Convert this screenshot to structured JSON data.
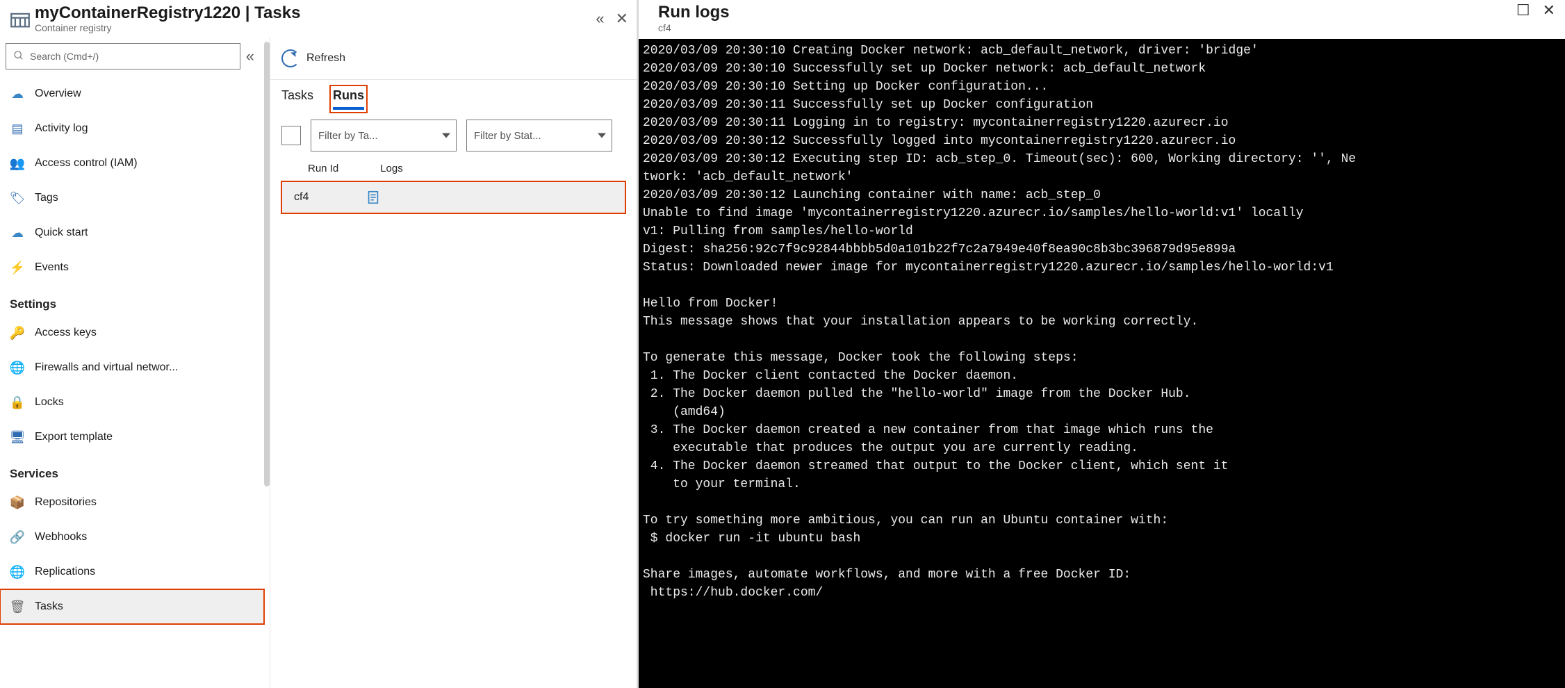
{
  "header": {
    "title": "myContainerRegistry1220 | Tasks",
    "subtitle": "Container registry"
  },
  "search": {
    "placeholder": "Search (Cmd+/)"
  },
  "sidebar": {
    "groups": [
      {
        "heading": "",
        "items": [
          {
            "id": "overview",
            "label": "Overview",
            "icon": "☁",
            "icon_color": "#3a87c7"
          },
          {
            "id": "activity-log",
            "label": "Activity log",
            "icon": "▤",
            "icon_color": "#2f6bb0"
          },
          {
            "id": "iam",
            "label": "Access control (IAM)",
            "icon": "👥",
            "icon_color": "#3a87c7"
          },
          {
            "id": "tags",
            "label": "Tags",
            "icon": "🏷",
            "icon_color": "#2f6bb0"
          },
          {
            "id": "quick-start",
            "label": "Quick start",
            "icon": "☁",
            "icon_color": "#3a87c7"
          },
          {
            "id": "events",
            "label": "Events",
            "icon": "⚡",
            "icon_color": "#f1b300"
          }
        ]
      },
      {
        "heading": "Settings",
        "items": [
          {
            "id": "access-keys",
            "label": "Access keys",
            "icon": "🔑",
            "icon_color": "#e8b400"
          },
          {
            "id": "firewalls",
            "label": "Firewalls and virtual networ...",
            "icon": "🌐",
            "icon_color": "#3aa043"
          },
          {
            "id": "locks",
            "label": "Locks",
            "icon": "🔒",
            "icon_color": "#3a87c7"
          },
          {
            "id": "export-template",
            "label": "Export template",
            "icon": "🖥",
            "icon_color": "#2f6bb0"
          }
        ]
      },
      {
        "heading": "Services",
        "items": [
          {
            "id": "repositories",
            "label": "Repositories",
            "icon": "📦",
            "icon_color": "#3a87c7"
          },
          {
            "id": "webhooks",
            "label": "Webhooks",
            "icon": "🔗",
            "icon_color": "#3a87c7"
          },
          {
            "id": "replications",
            "label": "Replications",
            "icon": "🌐",
            "icon_color": "#d08a2a"
          },
          {
            "id": "tasks",
            "label": "Tasks",
            "icon": "🗑",
            "icon_color": "#6e6e6e",
            "selected": true
          }
        ]
      }
    ]
  },
  "toolbar": {
    "refresh_label": "Refresh"
  },
  "tabs": [
    {
      "id": "tasks",
      "label": "Tasks",
      "active": false
    },
    {
      "id": "runs",
      "label": "Runs",
      "active": true
    }
  ],
  "filters": {
    "task": "Filter by Ta...",
    "status": "Filter by Stat..."
  },
  "grid": {
    "columns": [
      "Run Id",
      "Logs"
    ],
    "rows": [
      {
        "run_id": "cf4"
      }
    ]
  },
  "right": {
    "title": "Run logs",
    "subtitle": "cf4",
    "log": "2020/03/09 20:30:10 Creating Docker network: acb_default_network, driver: 'bridge'\n2020/03/09 20:30:10 Successfully set up Docker network: acb_default_network\n2020/03/09 20:30:10 Setting up Docker configuration...\n2020/03/09 20:30:11 Successfully set up Docker configuration\n2020/03/09 20:30:11 Logging in to registry: mycontainerregistry1220.azurecr.io\n2020/03/09 20:30:12 Successfully logged into mycontainerregistry1220.azurecr.io\n2020/03/09 20:30:12 Executing step ID: acb_step_0. Timeout(sec): 600, Working directory: '', Ne\ntwork: 'acb_default_network'\n2020/03/09 20:30:12 Launching container with name: acb_step_0\nUnable to find image 'mycontainerregistry1220.azurecr.io/samples/hello-world:v1' locally\nv1: Pulling from samples/hello-world\nDigest: sha256:92c7f9c92844bbbb5d0a101b22f7c2a7949e40f8ea90c8b3bc396879d95e899a\nStatus: Downloaded newer image for mycontainerregistry1220.azurecr.io/samples/hello-world:v1\n\nHello from Docker!\nThis message shows that your installation appears to be working correctly.\n\nTo generate this message, Docker took the following steps:\n 1. The Docker client contacted the Docker daemon.\n 2. The Docker daemon pulled the \"hello-world\" image from the Docker Hub.\n    (amd64)\n 3. The Docker daemon created a new container from that image which runs the\n    executable that produces the output you are currently reading.\n 4. The Docker daemon streamed that output to the Docker client, which sent it\n    to your terminal.\n\nTo try something more ambitious, you can run an Ubuntu container with:\n $ docker run -it ubuntu bash\n\nShare images, automate workflows, and more with a free Docker ID:\n https://hub.docker.com/"
  }
}
